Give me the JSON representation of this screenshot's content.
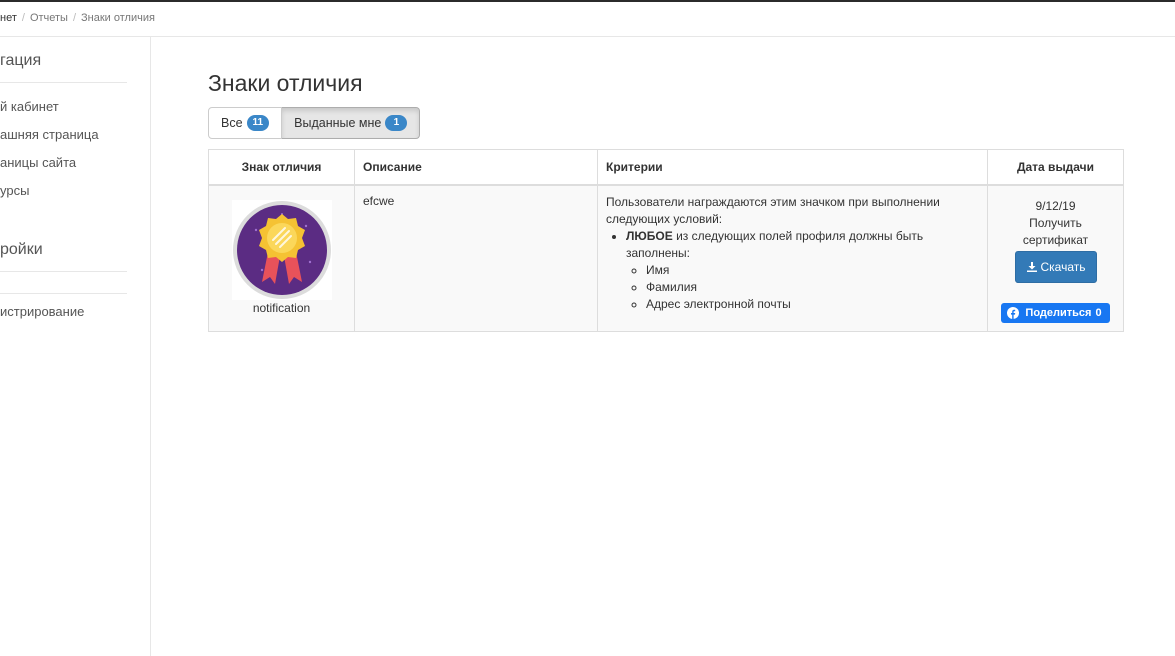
{
  "breadcrumb": [
    {
      "label": "нет"
    },
    {
      "label": "Отчеты"
    },
    {
      "label": "Знаки отличия"
    }
  ],
  "sidebar": {
    "section1_title": "гация",
    "section1_items": [
      "й кабинет",
      "ашняя страница",
      "аницы сайта",
      "урсы"
    ],
    "section2_title": "ройки",
    "section2_items": [
      "истрирование"
    ]
  },
  "page": {
    "title": "Знаки отличия",
    "filters": [
      {
        "label": "Все",
        "count": "11"
      },
      {
        "label": "Выданные мне",
        "count": "1"
      }
    ]
  },
  "table": {
    "headers": [
      "Знак отличия",
      "Описание",
      "Критерии",
      "Дата выдачи"
    ],
    "row": {
      "badge_name": "notification",
      "description": "efcwe",
      "criteria_intro": "Пользователи награждаются этим значком при выполнении следующих условий:",
      "criteria_any": "ЛЮБОЕ",
      "criteria_any_rest": " из следующих полей профиля должны быть заполнены:",
      "criteria_fields": [
        "Имя",
        "Фамилия",
        "Адрес электронной почты"
      ],
      "date": "9/12/19",
      "certificate_label": "Получить сертификат",
      "download_label": "Скачать",
      "share_label": "Поделиться",
      "share_count": "0"
    }
  },
  "colors": {
    "primary": "#337ab7",
    "badge": "#3a87c8",
    "facebook": "#1877f2",
    "medal_bg": "#5b2c83",
    "medal_gold": "#f5c233",
    "ribbon": "#e8525a"
  },
  "icons": {
    "download": "download-icon",
    "facebook": "facebook-icon",
    "medal": "medal-icon"
  }
}
